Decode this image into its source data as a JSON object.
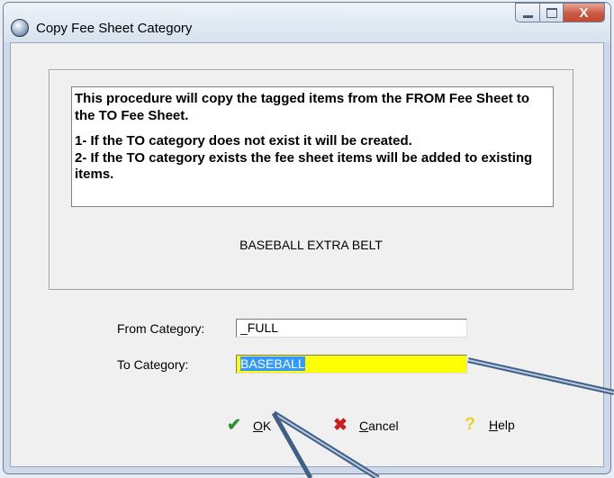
{
  "window": {
    "title": "Copy Fee Sheet Category",
    "close_glyph": "X"
  },
  "info": {
    "line1": "This procedure will copy the tagged items from the  FROM Fee Sheet to the TO Fee Sheet.",
    "line2": "1- If the TO category does not exist it will be created.",
    "line3": "2- If the TO category exists the fee sheet items will be added to existing items."
  },
  "caption": "BASEBALL EXTRA BELT",
  "form": {
    "from_label": "From Category:",
    "from_value": "_FULL",
    "to_label": "To Category:",
    "to_value": "BASEBALL"
  },
  "buttons": {
    "ok_hotkey": "O",
    "ok_rest": "K",
    "cancel_hotkey": "C",
    "cancel_rest": "ancel",
    "help_hotkey": "H",
    "help_rest": "elp"
  },
  "icons": {
    "app": "app-globe-icon",
    "ok": "checkmark-icon",
    "cancel": "cross-icon",
    "help": "question-mark-icon"
  },
  "colors": {
    "to_field_bg": "#ffff00",
    "selection": "#3399ff",
    "ok_icon": "#2f8f2f",
    "cancel_icon": "#cc1d1d",
    "help_icon": "#e8d31a",
    "annotation_arrow": "#3f5f84"
  }
}
